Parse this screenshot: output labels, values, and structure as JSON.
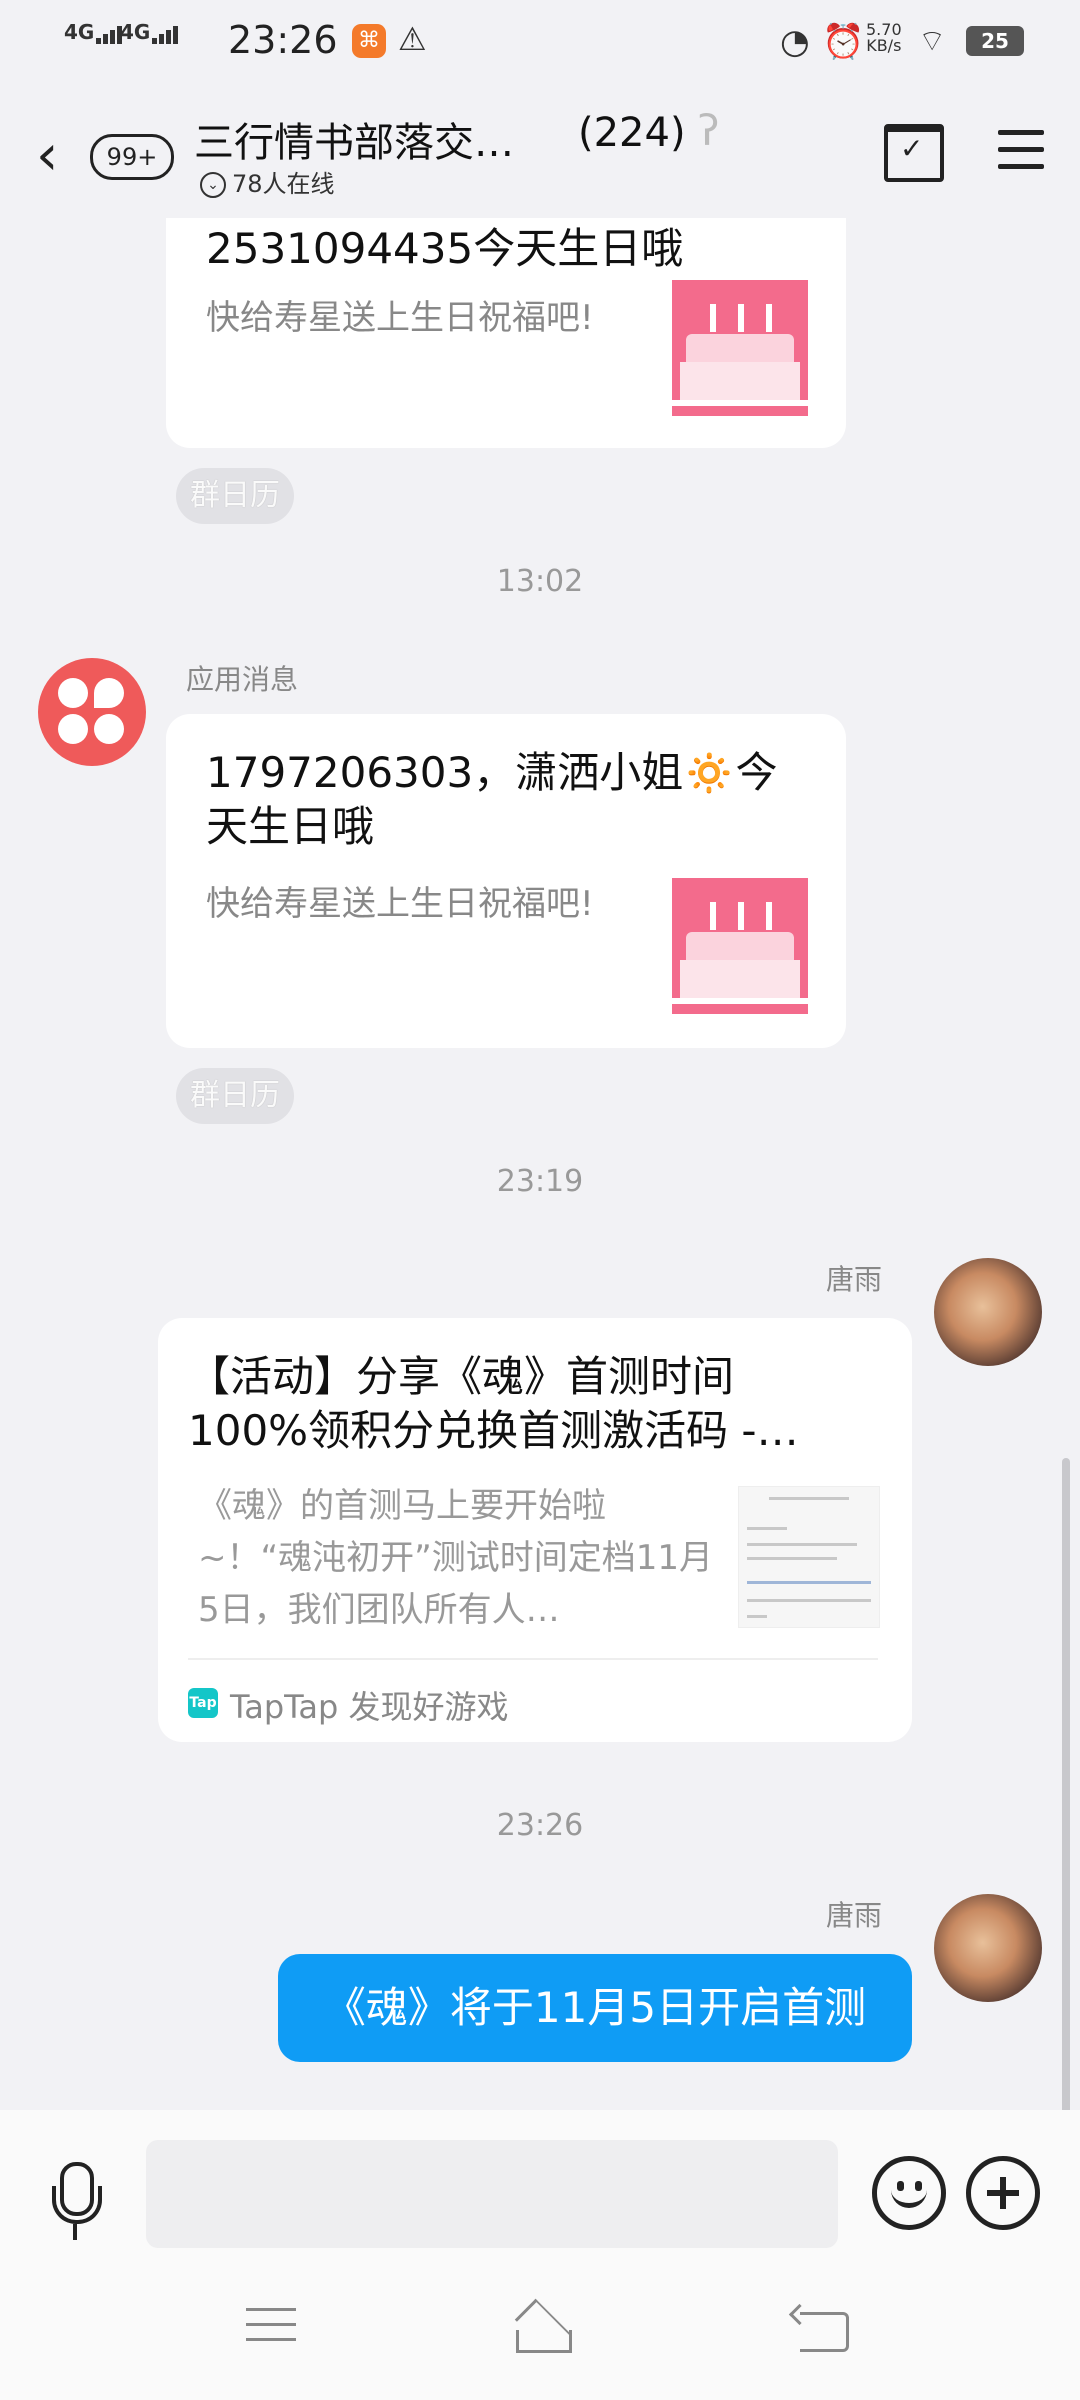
{
  "status_bar": {
    "network_1": "4G",
    "network_2": "4G",
    "time": "23:26",
    "speed_value": "5.70",
    "speed_unit": "KB/s",
    "battery": "25"
  },
  "header": {
    "back_badge": "99+",
    "group_name": "三行情书部落交…",
    "member_count": "(224)",
    "online_text": "78人在线"
  },
  "messages": {
    "card1": {
      "title": "2531094435今天生日哦",
      "subtitle": "快给寿星送上生日祝福吧!",
      "tag": "群日历"
    },
    "time1": "13:02",
    "card2": {
      "sender": "应用消息",
      "title_line1": "1797206303，潇洒小姐🔅今",
      "title_line2": "天生日哦",
      "subtitle": "快给寿星送上生日祝福吧!",
      "tag": "群日历"
    },
    "time2": "23:19",
    "share": {
      "sender": "唐雨",
      "title_line1": "【活动】分享《魂》首测时间",
      "title_line2": "100%领积分兑换首测激活码 -…",
      "desc": "《魂》的首测马上要开始啦~！“魂沌初开”测试时间定档11月5日，我们团队所有人…",
      "source_icon": "Tap",
      "source": "TapTap 发现好游戏"
    },
    "time3": "23:26",
    "last": {
      "sender": "唐雨",
      "text": "《魂》将于11月5日开启首测"
    }
  },
  "input": {
    "placeholder": ""
  }
}
